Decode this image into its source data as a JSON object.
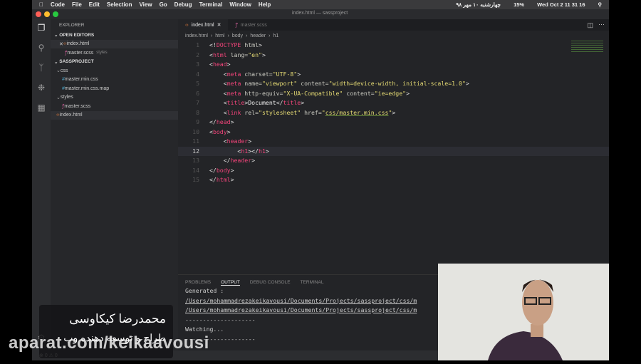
{
  "menubar": {
    "app": "Code",
    "items": [
      "File",
      "Edit",
      "Selection",
      "View",
      "Go",
      "Debug",
      "Terminal",
      "Window",
      "Help"
    ],
    "persian_date": "چهارشنبه ۱۰ مهر ۹۸",
    "battery": "15%",
    "clock": "Wed Oct 2  11 31 16"
  },
  "window_title": "index.html — sassproject",
  "explorer": {
    "title": "EXPLORER",
    "open_editors": "OPEN EDITORS",
    "open": [
      {
        "name": "index.html",
        "hint": ""
      },
      {
        "name": "master.scss",
        "hint": "styles"
      }
    ],
    "project": "SASSPROJECT",
    "tree": [
      {
        "name": "css",
        "kind": "folder",
        "depth": 1
      },
      {
        "name": "master.min.css",
        "kind": "css",
        "depth": 2
      },
      {
        "name": "master.min.css.map",
        "kind": "css",
        "depth": 2
      },
      {
        "name": "styles",
        "kind": "folder",
        "depth": 1
      },
      {
        "name": "master.scss",
        "kind": "scss",
        "depth": 2
      },
      {
        "name": "index.html",
        "kind": "html",
        "depth": 1
      }
    ]
  },
  "tabs": [
    {
      "label": "index.html",
      "active": true
    },
    {
      "label": "master.scss",
      "active": false
    }
  ],
  "breadcrumb": [
    "index.html",
    "html",
    "body",
    "header",
    "h1"
  ],
  "code": [
    [
      [
        "p",
        "<!"
      ],
      [
        "t",
        "DOCTYPE"
      ],
      [
        "p",
        " "
      ],
      [
        "a",
        "html"
      ],
      [
        "p",
        ">"
      ]
    ],
    [
      [
        "p",
        "<"
      ],
      [
        "t",
        "html"
      ],
      [
        "a",
        " lang="
      ],
      [
        "s",
        "\"en\""
      ],
      [
        "p",
        ">"
      ]
    ],
    [
      [
        "p",
        "<"
      ],
      [
        "t",
        "head"
      ],
      [
        "p",
        ">"
      ]
    ],
    [
      [
        "p",
        "    <"
      ],
      [
        "t",
        "meta"
      ],
      [
        "a",
        " charset="
      ],
      [
        "s",
        "\"UTF-8\""
      ],
      [
        "p",
        ">"
      ]
    ],
    [
      [
        "p",
        "    <"
      ],
      [
        "t",
        "meta"
      ],
      [
        "a",
        " name="
      ],
      [
        "s",
        "\"viewport\""
      ],
      [
        "a",
        " content="
      ],
      [
        "s",
        "\"width=device-width, initial-scale=1.0\""
      ],
      [
        "p",
        ">"
      ]
    ],
    [
      [
        "p",
        "    <"
      ],
      [
        "t",
        "meta"
      ],
      [
        "a",
        " http-equiv="
      ],
      [
        "s",
        "\"X-UA-Compatible\""
      ],
      [
        "a",
        " content="
      ],
      [
        "s",
        "\"ie=edge\""
      ],
      [
        "p",
        ">"
      ]
    ],
    [
      [
        "p",
        "    <"
      ],
      [
        "t",
        "title"
      ],
      [
        "p",
        ">"
      ],
      [
        "x",
        "Document"
      ],
      [
        "p",
        "</"
      ],
      [
        "t",
        "title"
      ],
      [
        "p",
        ">"
      ]
    ],
    [
      [
        "p",
        "    <"
      ],
      [
        "t",
        "link"
      ],
      [
        "a",
        " rel="
      ],
      [
        "s",
        "\"stylesheet\""
      ],
      [
        "a",
        " href="
      ],
      [
        "s",
        "\""
      ],
      [
        "u",
        "css/master.min.css"
      ],
      [
        "s",
        "\""
      ],
      [
        "p",
        ">"
      ]
    ],
    [
      [
        "p",
        "</"
      ],
      [
        "t",
        "head"
      ],
      [
        "p",
        ">"
      ]
    ],
    [
      [
        "p",
        "<"
      ],
      [
        "t",
        "body"
      ],
      [
        "p",
        ">"
      ]
    ],
    [
      [
        "p",
        "    <"
      ],
      [
        "t",
        "header"
      ],
      [
        "p",
        ">"
      ]
    ],
    [
      [
        "p",
        "        <"
      ],
      [
        "t",
        "h1"
      ],
      [
        "p",
        "></"
      ],
      [
        "t",
        "h1"
      ],
      [
        "p",
        ">"
      ]
    ],
    [
      [
        "p",
        "    </"
      ],
      [
        "t",
        "header"
      ],
      [
        "p",
        ">"
      ]
    ],
    [
      [
        "p",
        "</"
      ],
      [
        "t",
        "body"
      ],
      [
        "p",
        ">"
      ]
    ],
    [
      [
        "p",
        "</"
      ],
      [
        "t",
        "html"
      ],
      [
        "p",
        ">"
      ]
    ]
  ],
  "current_line": 12,
  "panel": {
    "tabs": [
      "PROBLEMS",
      "OUTPUT",
      "DEBUG CONSOLE",
      "TERMINAL"
    ],
    "active": "OUTPUT",
    "lines": [
      "Generated :",
      "/Users/mohammadrezakeikavousi/Documents/Projects/sassproject/css/m",
      "/Users/mohammadrezakeikavousi/Documents/Projects/sassproject/css/m",
      "--------------------",
      "Watching...",
      "--------------------"
    ]
  },
  "status": {
    "errors": "0",
    "warnings": "0"
  },
  "caption": {
    "name": "محمدرضا کیکاوسی",
    "role": "طراح و توسعه دهنده وب"
  },
  "watermark": "aparat.com/keikaavousi",
  "colors": {
    "tag": "#f2447a",
    "string": "#e6db74",
    "bg": "#232427"
  }
}
